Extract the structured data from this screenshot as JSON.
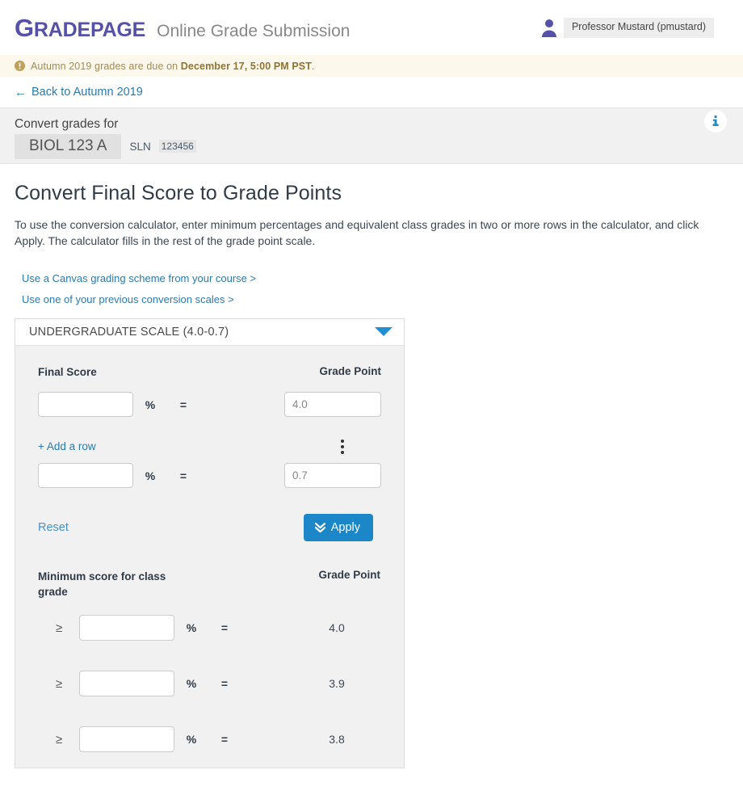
{
  "header": {
    "logo_text": "GRADEPAGE",
    "logo_cap": "G",
    "logo_rest": "RADEPAGE",
    "tagline": "Online Grade Submission",
    "user_name": "Professor Mustard (pmustard)",
    "avatar_icon": "user-avatar-icon"
  },
  "notice": {
    "icon": "exclamation-circle-icon",
    "text_prefix": "Autumn 2019 grades are due on ",
    "text_bold": "December 17, 5:00 PM PST",
    "text_suffix": "."
  },
  "back": {
    "arrow": "←",
    "label": "Back to Autumn 2019"
  },
  "course": {
    "label": "Convert grades for",
    "code": "BIOL 123 A",
    "sln_label": "SLN",
    "sln_value": "123456",
    "info_icon": "info-circle-icon"
  },
  "main": {
    "title": "Convert Final Score to Grade Points",
    "description": "To use the conversion calculator, enter minimum percentages and equivalent class grades in two or more rows in the calculator, and click Apply. The calculator fills in the rest of the grade point scale.",
    "links": [
      {
        "label": "Use a Canvas grading scheme from your course >"
      },
      {
        "label": "Use one of your previous conversion scales >"
      }
    ]
  },
  "calculator": {
    "scale_name": "UNDERGRADUATE SCALE (4.0-0.7)",
    "chevron_icon": "chevron-down-icon",
    "col_final_score": "Final Score",
    "col_grade_point": "Grade Point",
    "percent_symbol": "%",
    "equals_symbol": "=",
    "rows": [
      {
        "score_value": "",
        "score_placeholder": "",
        "grade_point": "4.0"
      },
      {
        "score_value": "",
        "score_placeholder": "",
        "grade_point": "0.7"
      }
    ],
    "add_row_label": "+ Add a row",
    "kebab_icon": "kebab-menu-icon",
    "reset_label": "Reset",
    "apply_label": "Apply",
    "apply_icon": "double-chevron-down-icon",
    "apply_color": "#1b87c9"
  },
  "results": {
    "col_min_score": "Minimum score for class grade",
    "col_grade_point": "Grade Point",
    "gte_symbol": "≥",
    "percent_symbol": "%",
    "equals_symbol": "=",
    "rows": [
      {
        "score_value": "",
        "grade_point": "4.0"
      },
      {
        "score_value": "",
        "grade_point": "3.9"
      },
      {
        "score_value": "",
        "grade_point": "3.8"
      }
    ]
  }
}
